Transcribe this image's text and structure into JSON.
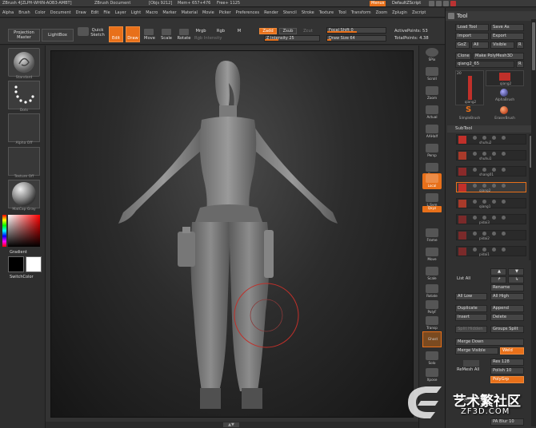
{
  "titlebar": {
    "app": "ZBrush 4[ZLPH-WHIN-AOB3-AMBT]",
    "document": "ZBrush Document",
    "objs": "[Objs 9212]",
    "mem": "Mem+ 657+476",
    "free": "Free+ 1125",
    "menus_label": "Menus",
    "script_label": "DefaultZScript"
  },
  "menubar": {
    "items": [
      "Alpha",
      "Brush",
      "Color",
      "Document",
      "Draw",
      "Edit",
      "File",
      "Layer",
      "Light",
      "Macro",
      "Marker",
      "Material",
      "Movie",
      "Picker",
      "Preferences",
      "Render",
      "Stencil",
      "Stroke",
      "Texture",
      "Tool",
      "Transform",
      "Zoom",
      "Zplugin",
      "Zscript"
    ]
  },
  "toolbar": {
    "projection_master": "Projection Master",
    "lightbox": "LightBox",
    "quick_sketch": "Quick Sketch",
    "edit": "Edit",
    "draw": "Draw",
    "move": "Move",
    "scale": "Scale",
    "rotate": "Rotate",
    "mrgb": "Mrgb",
    "rgb": "Rgb",
    "m": "M",
    "rgb_intensity": "Rgb Intensity",
    "zadd": "Zadd",
    "zsub": "Zsub",
    "zcut": "Zcut",
    "z_intensity": "Z Intensity 25",
    "z_intensity_value": 25,
    "focal_shift": "Focal Shift 0",
    "focal_shift_value": 0,
    "draw_size": "Draw Size 64",
    "draw_size_value": 64,
    "active_points": "ActivePoints: 53",
    "total_points": "TotalPoints: 4.38"
  },
  "leftpanel": {
    "brush_label": "Standard",
    "stroke_label": "Dots",
    "alpha_label": "Alpha Off",
    "texture_label": "Texture Off",
    "material_label": "MatCap Gray",
    "gradient_label": "Gradient",
    "switchcolor_label": "SwitchColor"
  },
  "rightshelf": {
    "items": [
      "SPix",
      "Scroll",
      "Zoom",
      "Actual",
      "AAHalf",
      "Persp",
      "Floor",
      "Local",
      "L.Sym",
      "Qxyz",
      "Frame",
      "Move",
      "Scale",
      "Rotate",
      "PolyF",
      "Transp",
      "Ghost",
      "Solo",
      "Xpose"
    ]
  },
  "palette": {
    "title": "Tool",
    "load_tool": "Load Tool",
    "save_as": "Save As",
    "import": "Import",
    "export": "Export",
    "goz": "GoZ",
    "all": "All",
    "visible": "Visible",
    "r": "R",
    "clone": "Clone",
    "make_polymesh": "Make PolyMesh3D",
    "current_tool": "qiang2_65",
    "r2": "R",
    "thumbs": [
      "qiang2",
      "qiang2",
      "AlphaBrush",
      "SimpleBrush",
      "EraserBrush"
    ],
    "thumb_count": "20",
    "subtool_header": "SubTool",
    "subtools": [
      "shuhu2",
      "shuhu1",
      "shang01",
      "qiang2",
      "qiang1",
      "pidai3",
      "pidai2",
      "pidai1"
    ],
    "list_all": "List All",
    "rename": "Rename",
    "all_low": "All Low",
    "all_high": "All High",
    "duplicate": "Duplicate",
    "append": "Append",
    "insert": "Insert",
    "delete": "Delete",
    "split_hidden": "Split Hidden",
    "groups_split": "Groups Split",
    "merge_down": "Merge Down",
    "merge_visible": "Merge Visible",
    "weld": "Weld",
    "res": "Res 128",
    "remesh_all": "ReMesh All",
    "polish": "Polish 10",
    "polygrp": "PolyGrp",
    "project": "Project",
    "pa_blur": "PA Blur 10"
  },
  "watermark": {
    "text": "艺术繁社区",
    "url": "ZF3D.COM"
  },
  "colors": {
    "accent": "#e8701a",
    "background": "#2b2b2b",
    "brush_ring": "#c0302a"
  }
}
